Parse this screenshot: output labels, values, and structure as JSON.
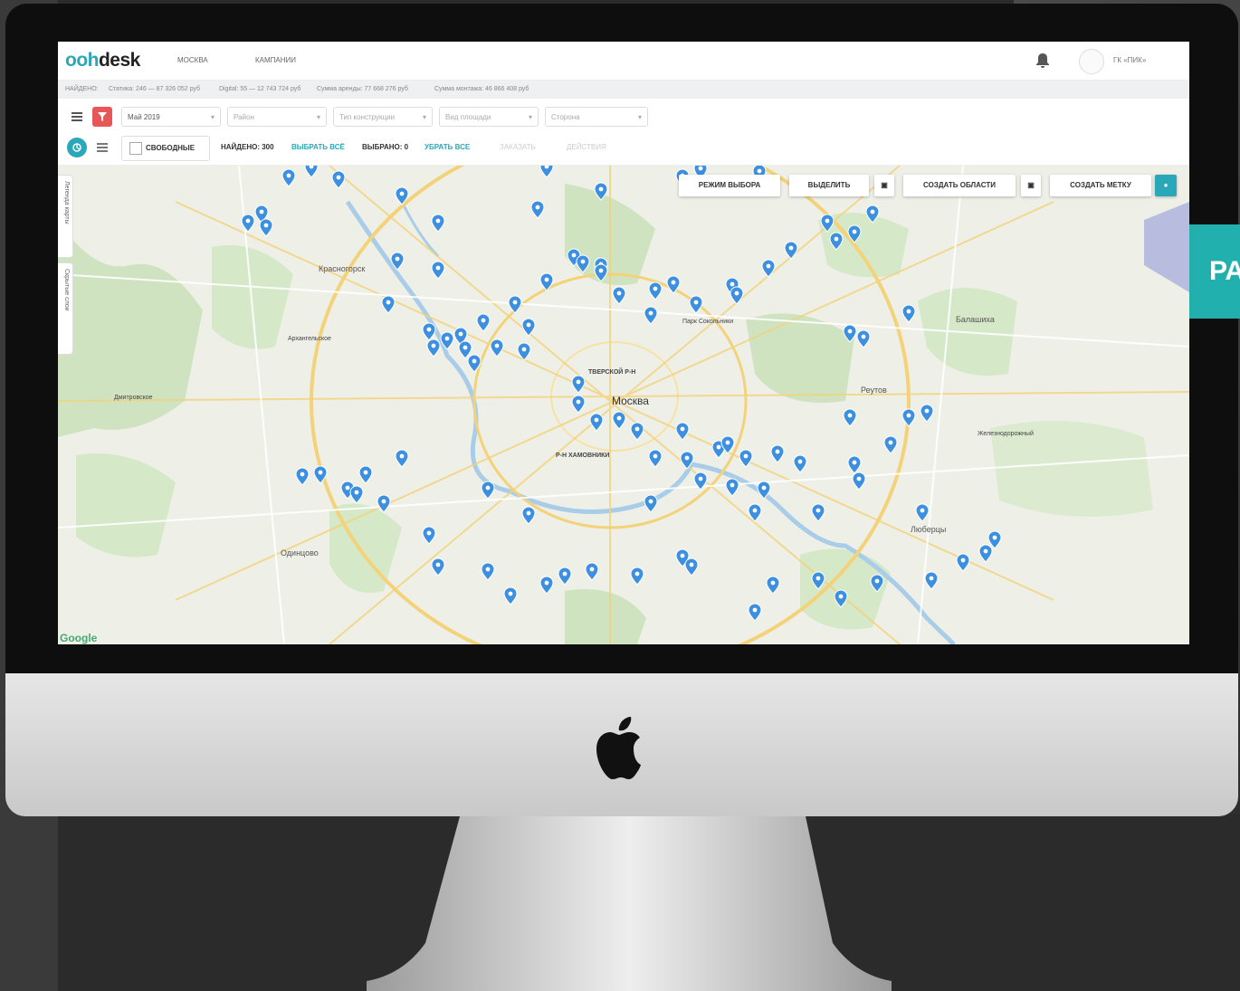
{
  "app": {
    "logo_prefix": "ooh",
    "logo_suffix": "desk",
    "nav": [
      "МОСКВА",
      "КАМПАНИИ"
    ],
    "user_name": "ГК «ПИК»"
  },
  "summary": {
    "found": "НАЙДЕНО:",
    "static": "Статика: 246 — 87 326 052 руб",
    "digital": "Digital: 55 — 12 743 724 руб",
    "rent_sum": "Сумма аренды: 77 668 276 руб",
    "install_sum": "Сумма монтажа: 46 866 408 руб"
  },
  "filters": {
    "month": "Май 2019",
    "district": "Район",
    "construction_type": "Тип конструкции",
    "surface": "Вид площади",
    "sides": "Сторона"
  },
  "actions": {
    "free_checkbox": "СВОБОДНЫЕ",
    "found_count": "НАЙДЕНО: 300",
    "select_all": "ВЫБРАТЬ ВСЁ",
    "selected": "ВЫБРАНО: 0",
    "clear_all": "УБРАТЬ ВСЕ",
    "apply": "ЗАКАЗАТЬ",
    "more_actions": "ДЕЙСТВИЯ"
  },
  "map_toolbar": {
    "select_mode": "РЕЖИМ ВЫБОРА",
    "highlight": "ВЫДЕЛИТЬ",
    "create_area": "СОЗДАТЬ ОБЛАСТИ",
    "create_marker": "СОЗДАТЬ МЕТКУ"
  },
  "side_tabs": [
    "Легенда карты",
    "Скрытые слои"
  ],
  "map_labels": {
    "center_city": "Москва",
    "balashikha": "Балашиха",
    "reutov": "Реутов",
    "zheleznodorozhny": "Железнодорожный",
    "krasnogorsk": "Красногорск",
    "odintsovo": "Одинцово",
    "lyubertsy": "Люберцы",
    "tverskoy": "ТВЕРСКОЙ Р-Н",
    "khamovniki": "Р-Н ХАМОВНИКИ",
    "arkhangelskoe": "Архангельское",
    "park_sokolniki": "Парк Сокольники",
    "dmitrovskoe": "Дмитровское",
    "google": "Google"
  },
  "badge": "РА",
  "colors": {
    "accent": "#2aa7b8",
    "pin": "#3d8fe0",
    "badge": "#22b0ae",
    "red_button": "#e85757"
  },
  "marker_icon": "map-pin-icon"
}
